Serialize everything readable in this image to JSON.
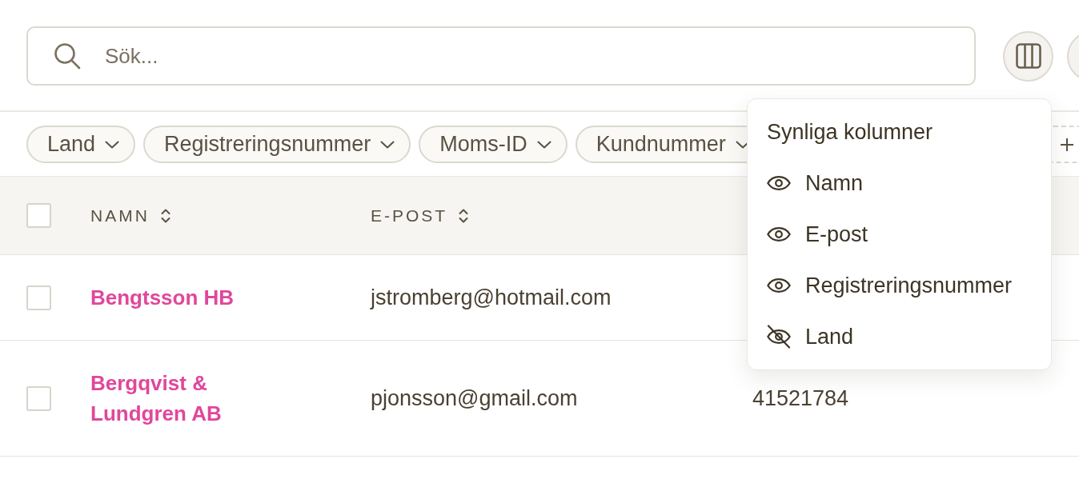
{
  "search": {
    "placeholder": "Sök..."
  },
  "filters": [
    {
      "label": "Land"
    },
    {
      "label": "Registreringsnummer"
    },
    {
      "label": "Moms-ID"
    },
    {
      "label": "Kundnummer"
    }
  ],
  "table": {
    "all_checked": false,
    "columns": [
      {
        "label": "NAMN"
      },
      {
        "label": "E-POST"
      }
    ],
    "rows": [
      {
        "checked": false,
        "name": "Bengtsson HB",
        "email": "jstromberg@hotmail.com"
      },
      {
        "checked": false,
        "name": "Bergqvist & Lundgren AB",
        "email": "pjonsson@gmail.com",
        "column_3": "41521784"
      }
    ]
  },
  "column_menu": {
    "title": "Synliga kolumner",
    "items": [
      {
        "label": "Namn",
        "visible": true
      },
      {
        "label": "E-post",
        "visible": true
      },
      {
        "label": "Registreringsnummer",
        "visible": true
      },
      {
        "label": "Land",
        "visible": false
      }
    ]
  }
}
